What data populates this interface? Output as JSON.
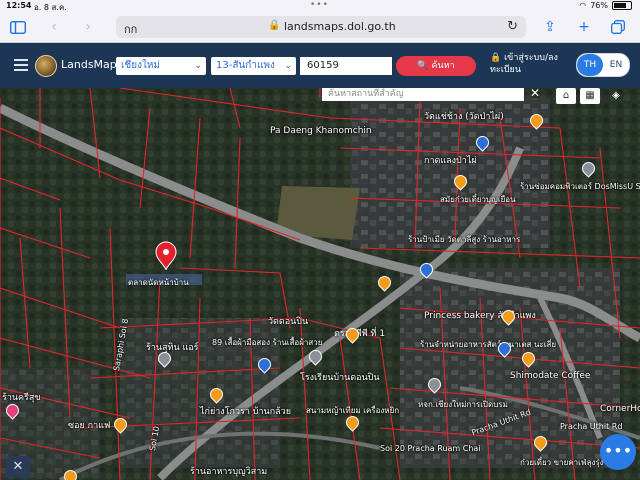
{
  "status": {
    "time": "12:54",
    "date": "อ. 8 ส.ค.",
    "battery": "76%"
  },
  "browser": {
    "aa": "กก",
    "url": "landsmaps.dol.go.th"
  },
  "header": {
    "brand": "LandsMaps",
    "province": "เชียงใหม่",
    "district": "13-สันกำแพง",
    "parcel_no": "60159",
    "search_label": "ค้นหา",
    "login_label": "เข้าสู่ระบบ/ลงทะเบียน",
    "lang_th": "TH",
    "lang_en": "EN"
  },
  "map": {
    "place_search_placeholder": "ค้นหาสถานที่สำคัญ",
    "labels": [
      "Pa Daeng Khanomchin",
      "วัดแช่ช้าง (วัดป่าไผ่)",
      "กาดแลงป่าไผ่",
      "ร้านซ่อมคอมพิวเตอร์ DosMissU System",
      "สมัยก๋วยเตี๋ยวบุญเยือน",
      "ร้านป้าเมีย วัดตาลีสูง ร้านอาหาร",
      "ตลาดนัดหน้าบ้าน",
      "วัดดอนปิน",
      "ตรอ. พีพี ที่ 1",
      "Princess bakery สันกำแพง",
      "ร้านสุทิน แอร์",
      "89 เสื้อผ้ามือสอง ร้านเสื้อผ้าสวย",
      "ร้านจำหน่ายอาหารสัตว์ อนาเตส นะเสี่ย",
      "Shimodate Coffee",
      "โรงเรียนบ้านดอนปิน",
      "Saraphi Soi 8",
      "ไก่ย่างโกวรา บ้านกล้วย",
      "สนามหญ้าเทียม เครื่องหยิก",
      "หจก.เชียงใหม่การเปิดบรม",
      "Pracha Uthit Rd",
      "ร้านครีสุข",
      "ซอย กาแฟ",
      "Soi 10",
      "ร้านอาหารบุญวิสาม",
      "Soi 20 Pracha Ruam Chai",
      "ก๋วยเตี๋ยว ขายคาเฟ่ลุงรุ่ง",
      "CornerHouse",
      "Pracha Uthit Rd"
    ]
  }
}
